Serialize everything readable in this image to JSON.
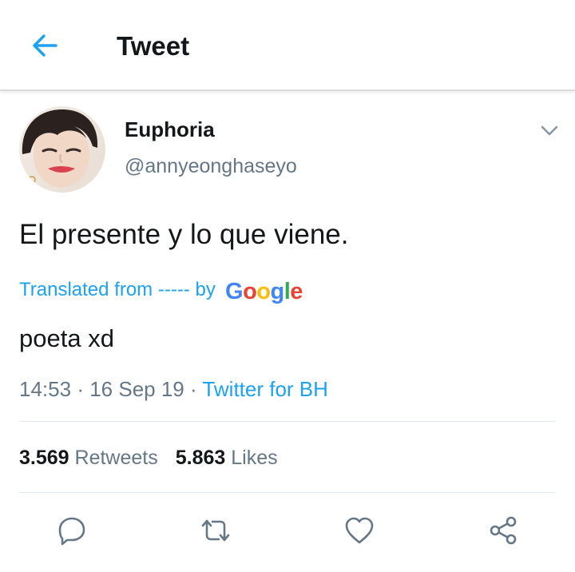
{
  "header": {
    "title": "Tweet",
    "back_icon": "arrow-left-icon"
  },
  "tweet": {
    "author": {
      "display_name": "Euphoria",
      "handle": "@annyeonghaseyo"
    },
    "text": "El presente y lo que viene.",
    "translation": {
      "label": "Translated from ----- by",
      "provider": "Google",
      "text": "poeta xd"
    },
    "meta": {
      "time": "14:53",
      "separator": "·",
      "date": "16 Sep 19",
      "source": "Twitter for BH"
    },
    "stats": {
      "retweets_count": "3.569",
      "retweets_label": "Retweets",
      "likes_count": "5.863",
      "likes_label": "Likes"
    },
    "actions": [
      "reply-icon",
      "retweet-icon",
      "like-icon",
      "share-icon"
    ]
  },
  "colors": {
    "accent": "#1da1f2",
    "text": "#14171a",
    "muted": "#657786",
    "google_blue": "#4285f4",
    "google_red": "#ea4335",
    "google_yellow": "#fbbc05",
    "google_green": "#34a853"
  }
}
